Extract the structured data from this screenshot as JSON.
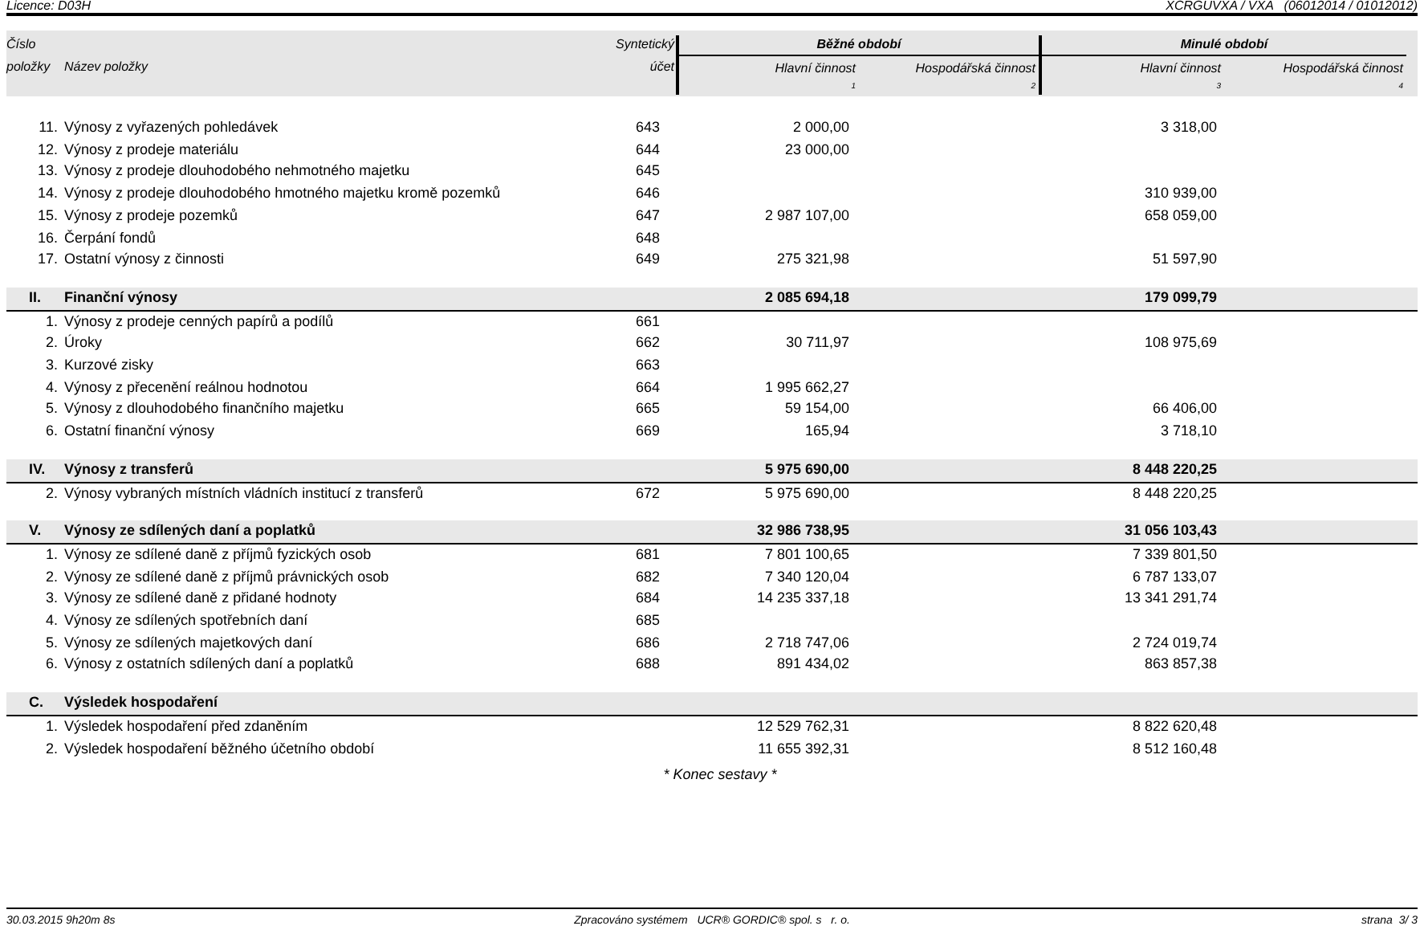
{
  "page_header": {
    "licence": "Licence: D03H",
    "report_code": "XCRGUVXA / VXA   (06012014 / 01012012)"
  },
  "table_header": {
    "number_label": [
      "Číslo",
      "položky"
    ],
    "name_label": "Název položky",
    "account_label": [
      "Syntetický",
      "účet"
    ],
    "periods": [
      {
        "title": "Běžné období",
        "columns": [
          {
            "label": "Hlavní činnost",
            "index": "1"
          },
          {
            "label": "Hospodářská činnost",
            "index": "2"
          }
        ]
      },
      {
        "title": "Minulé období",
        "columns": [
          {
            "label": "Hlavní činnost",
            "index": "3"
          },
          {
            "label": "Hospodářská činnost",
            "index": "4"
          }
        ]
      }
    ]
  },
  "blocks": [
    {
      "items": [
        {
          "number": "11.",
          "name": "Výnosy z vyřazených pohledávek",
          "account": "643",
          "current_main": "2 000,00",
          "prior_main": "3 318,00"
        },
        {
          "number": "12.",
          "name": "Výnosy z prodeje materiálu",
          "account": "644",
          "current_main": "23 000,00"
        },
        {
          "number": "13.",
          "name": "Výnosy z prodeje dlouhodobého nehmotného majetku",
          "account": "645"
        },
        {
          "number": "14.",
          "name": "Výnosy z prodeje dlouhodobého hmotného majetku kromě pozemků",
          "account": "646",
          "prior_main": "310 939,00"
        },
        {
          "number": "15.",
          "name": "Výnosy z prodeje pozemků",
          "account": "647",
          "current_main": "2 987 107,00",
          "prior_main": "658 059,00"
        },
        {
          "number": "16.",
          "name": "Čerpání fondů",
          "account": "648"
        },
        {
          "number": "17.",
          "name": "Ostatní výnosy z činnosti",
          "account": "649",
          "current_main": "275 321,98",
          "prior_main": "51 597,90"
        }
      ]
    },
    {
      "heading": {
        "number": "II.",
        "name": "Finanční výnosy",
        "current_main": "2 085 694,18",
        "prior_main": "179 099,79"
      },
      "items": [
        {
          "number": "1.",
          "name": "Výnosy z prodeje cenných papírů a podílů",
          "account": "661"
        },
        {
          "number": "2.",
          "name": "Úroky",
          "account": "662",
          "current_main": "30 711,97",
          "prior_main": "108 975,69"
        },
        {
          "number": "3.",
          "name": "Kurzové zisky",
          "account": "663"
        },
        {
          "number": "4.",
          "name": "Výnosy z přecenění reálnou hodnotou",
          "account": "664",
          "current_main": "1 995 662,27"
        },
        {
          "number": "5.",
          "name": "Výnosy z dlouhodobého finančního majetku",
          "account": "665",
          "current_main": "59 154,00",
          "prior_main": "66 406,00"
        },
        {
          "number": "6.",
          "name": "Ostatní finanční výnosy",
          "account": "669",
          "current_main": "165,94",
          "prior_main": "3 718,10"
        }
      ]
    },
    {
      "heading": {
        "number": "IV.",
        "name": "Výnosy z transferů",
        "current_main": "5 975 690,00",
        "prior_main": "8 448 220,25"
      },
      "items": [
        {
          "number": "2.",
          "name": "Výnosy vybraných místních vládních institucí z transferů",
          "account": "672",
          "current_main": "5 975 690,00",
          "prior_main": "8 448 220,25"
        }
      ]
    },
    {
      "heading": {
        "number": "V.",
        "name": "Výnosy ze sdílených daní a poplatků",
        "current_main": "32 986 738,95",
        "prior_main": "31 056 103,43"
      },
      "items": [
        {
          "number": "1.",
          "name": "Výnosy ze sdílené daně z příjmů fyzických osob",
          "account": "681",
          "current_main": "7 801 100,65",
          "prior_main": "7 339 801,50"
        },
        {
          "number": "2.",
          "name": "Výnosy ze sdílené daně z příjmů právnických osob",
          "account": "682",
          "current_main": "7 340 120,04",
          "prior_main": "6 787 133,07"
        },
        {
          "number": "3.",
          "name": "Výnosy ze sdílené daně z přidané hodnoty",
          "account": "684",
          "current_main": "14 235 337,18",
          "prior_main": "13 341 291,74"
        },
        {
          "number": "4.",
          "name": "Výnosy ze sdílených spotřebních daní",
          "account": "685"
        },
        {
          "number": "5.",
          "name": "Výnosy ze sdílených majetkových daní",
          "account": "686",
          "current_main": "2 718 747,06",
          "prior_main": "2 724 019,74"
        },
        {
          "number": "6.",
          "name": "Výnosy z ostatních sdílených daní a poplatků",
          "account": "688",
          "current_main": "891 434,02",
          "prior_main": "863 857,38"
        }
      ]
    },
    {
      "heading": {
        "number": "C.",
        "name": "Výsledek hospodaření"
      },
      "items": [
        {
          "number": "1.",
          "name": "Výsledek hospodaření před zdaněním",
          "current_main": "12 529 762,31",
          "prior_main": "8 822 620,48"
        },
        {
          "number": "2.",
          "name": "Výsledek hospodaření běžného účetního období",
          "current_main": "11 655 392,31",
          "prior_main": "8 512 160,48"
        }
      ]
    }
  ],
  "end_note": "* Konec sestavy *",
  "footer": {
    "printed": "30.03.2015 9h20m 8s",
    "system": "Zpracováno systémem   UCR® GORDIC® spol. s   r. o.",
    "page": "strana  3/ 3"
  }
}
